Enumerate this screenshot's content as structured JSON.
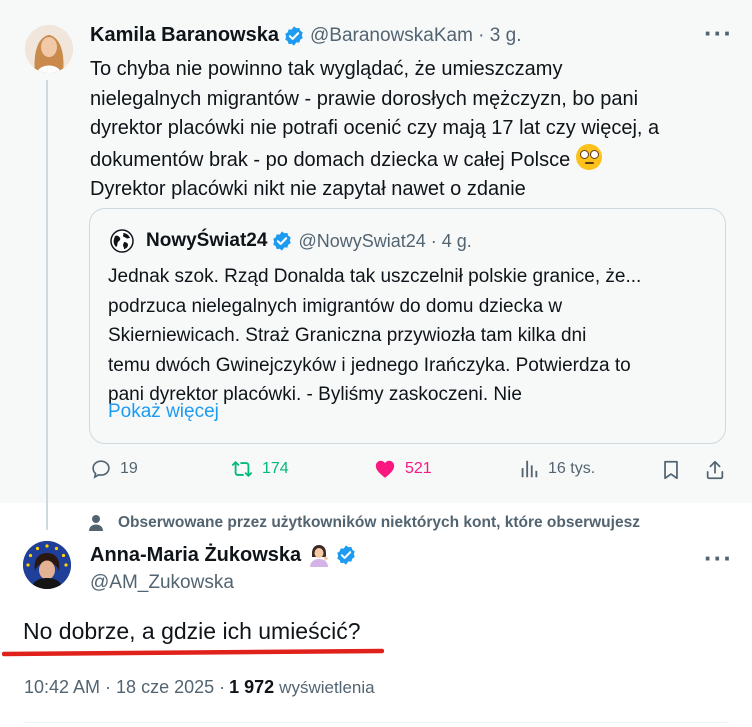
{
  "colors": {
    "accent": "#1d9bf0",
    "secondary_text": "#536471",
    "retweet": "#00ba7c",
    "like": "#f91880",
    "underline": "#e0211b"
  },
  "parent_tweet": {
    "author_name": "Kamila Baranowska",
    "handle_time": "@BaranowskaKam · 3 g.",
    "text_lines": [
      "To chyba nie powinno tak wyglądać, że umieszczamy",
      "nielegalnych migrantów - prawie dorosłych mężczyzn, bo pani",
      "dyrektor placówki nie potrafi ocenić czy mają 17 lat czy więcej, a",
      "dokumentów brak - po domach dziecka w całej Polsce",
      "Dyrektor placówki nikt nie zapytał nawet o zdanie"
    ],
    "emoji": "face-with-rolling-eyes",
    "more_icon": "more-icon",
    "quote": {
      "author_name": "NowyŚwiat24",
      "handle_time": "@NowySwiat24 · 4 g.",
      "text_lines": [
        "Jednak szok. Rząd Donalda tak uszczelnił polskie granice, że...",
        "podrzuca nielegalnych imigrantów do domu dziecka w",
        "Skierniewicach. Straż Graniczna przywiozła tam kilka dni",
        "temu dwóch Gwinejczyków i jednego Irańczyka. Potwierdza to",
        "pani dyrektor placówki. - Byliśmy zaskoczeni. Nie"
      ],
      "show_more": "Pokaż więcej"
    },
    "actions": {
      "replies": "19",
      "retweets": "174",
      "likes": "521",
      "views": "16 tys."
    }
  },
  "context_line": "Obserwowane przez użytkowników niektórych kont, które obserwujesz",
  "reply_tweet": {
    "author_name": "Anna-Maria Żukowska",
    "handle": "@AM_Zukowska",
    "emoji": "person-tipping-hand",
    "text": "No dobrze, a gdzie ich umieścić?",
    "time_date": "10:42 AM · 18 cze 2025 · ",
    "views_count": "1 972",
    "views_label": "wyświetlenia"
  }
}
